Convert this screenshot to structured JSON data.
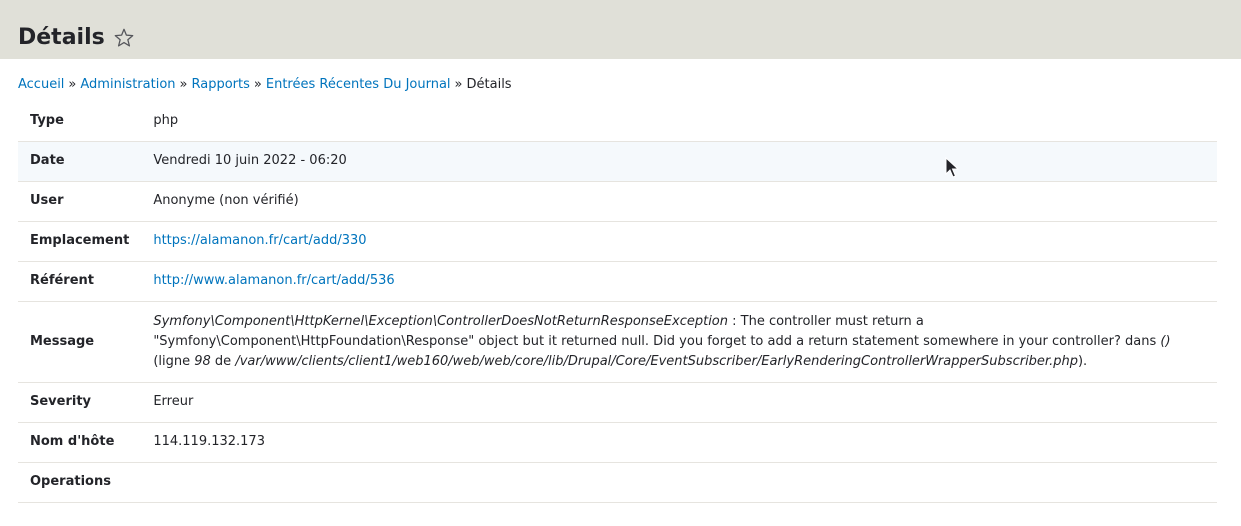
{
  "header": {
    "title": "Détails",
    "star_icon": "star-outline-icon"
  },
  "breadcrumb": {
    "items": [
      "Accueil",
      "Administration",
      "Rapports",
      "Entrées Récentes Du Journal"
    ],
    "separator": "»",
    "current": "Détails"
  },
  "details": {
    "type": {
      "label": "Type",
      "value": "php"
    },
    "date": {
      "label": "Date",
      "value": "Vendredi 10 juin 2022 - 06:20"
    },
    "user": {
      "label": "User",
      "value": "Anonyme (non vérifié)"
    },
    "location": {
      "label": "Emplacement",
      "value": "https://alamanon.fr/cart/add/330"
    },
    "referrer": {
      "label": "Référent",
      "value": "http://www.alamanon.fr/cart/add/536"
    },
    "message": {
      "label": "Message",
      "exception": "Symfony\\Component\\HttpKernel\\Exception\\ControllerDoesNotReturnResponseException",
      "text1": " : The controller must return a \"Symfony\\Component\\HttpFoundation\\Response\" object but it returned null. Did you forget to add a return statement somewhere in your controller? dans ",
      "func": "()",
      "text2": " (ligne ",
      "line": "98",
      "text3": " de ",
      "file": "/var/www/clients/client1/web160/web/web/core/lib/Drupal/Core/EventSubscriber/EarlyRenderingControllerWrapperSubscriber.php",
      "text4": ")."
    },
    "severity": {
      "label": "Severity",
      "value": "Erreur"
    },
    "hostname": {
      "label": "Nom d'hôte",
      "value": "114.119.132.173"
    },
    "operations": {
      "label": "Operations",
      "value": ""
    }
  },
  "colors": {
    "header_bg": "#e0e0d8",
    "link": "#0074bd",
    "text": "#232429",
    "row_highlight": "#f5f9fc",
    "row_border": "#e6e4df"
  }
}
